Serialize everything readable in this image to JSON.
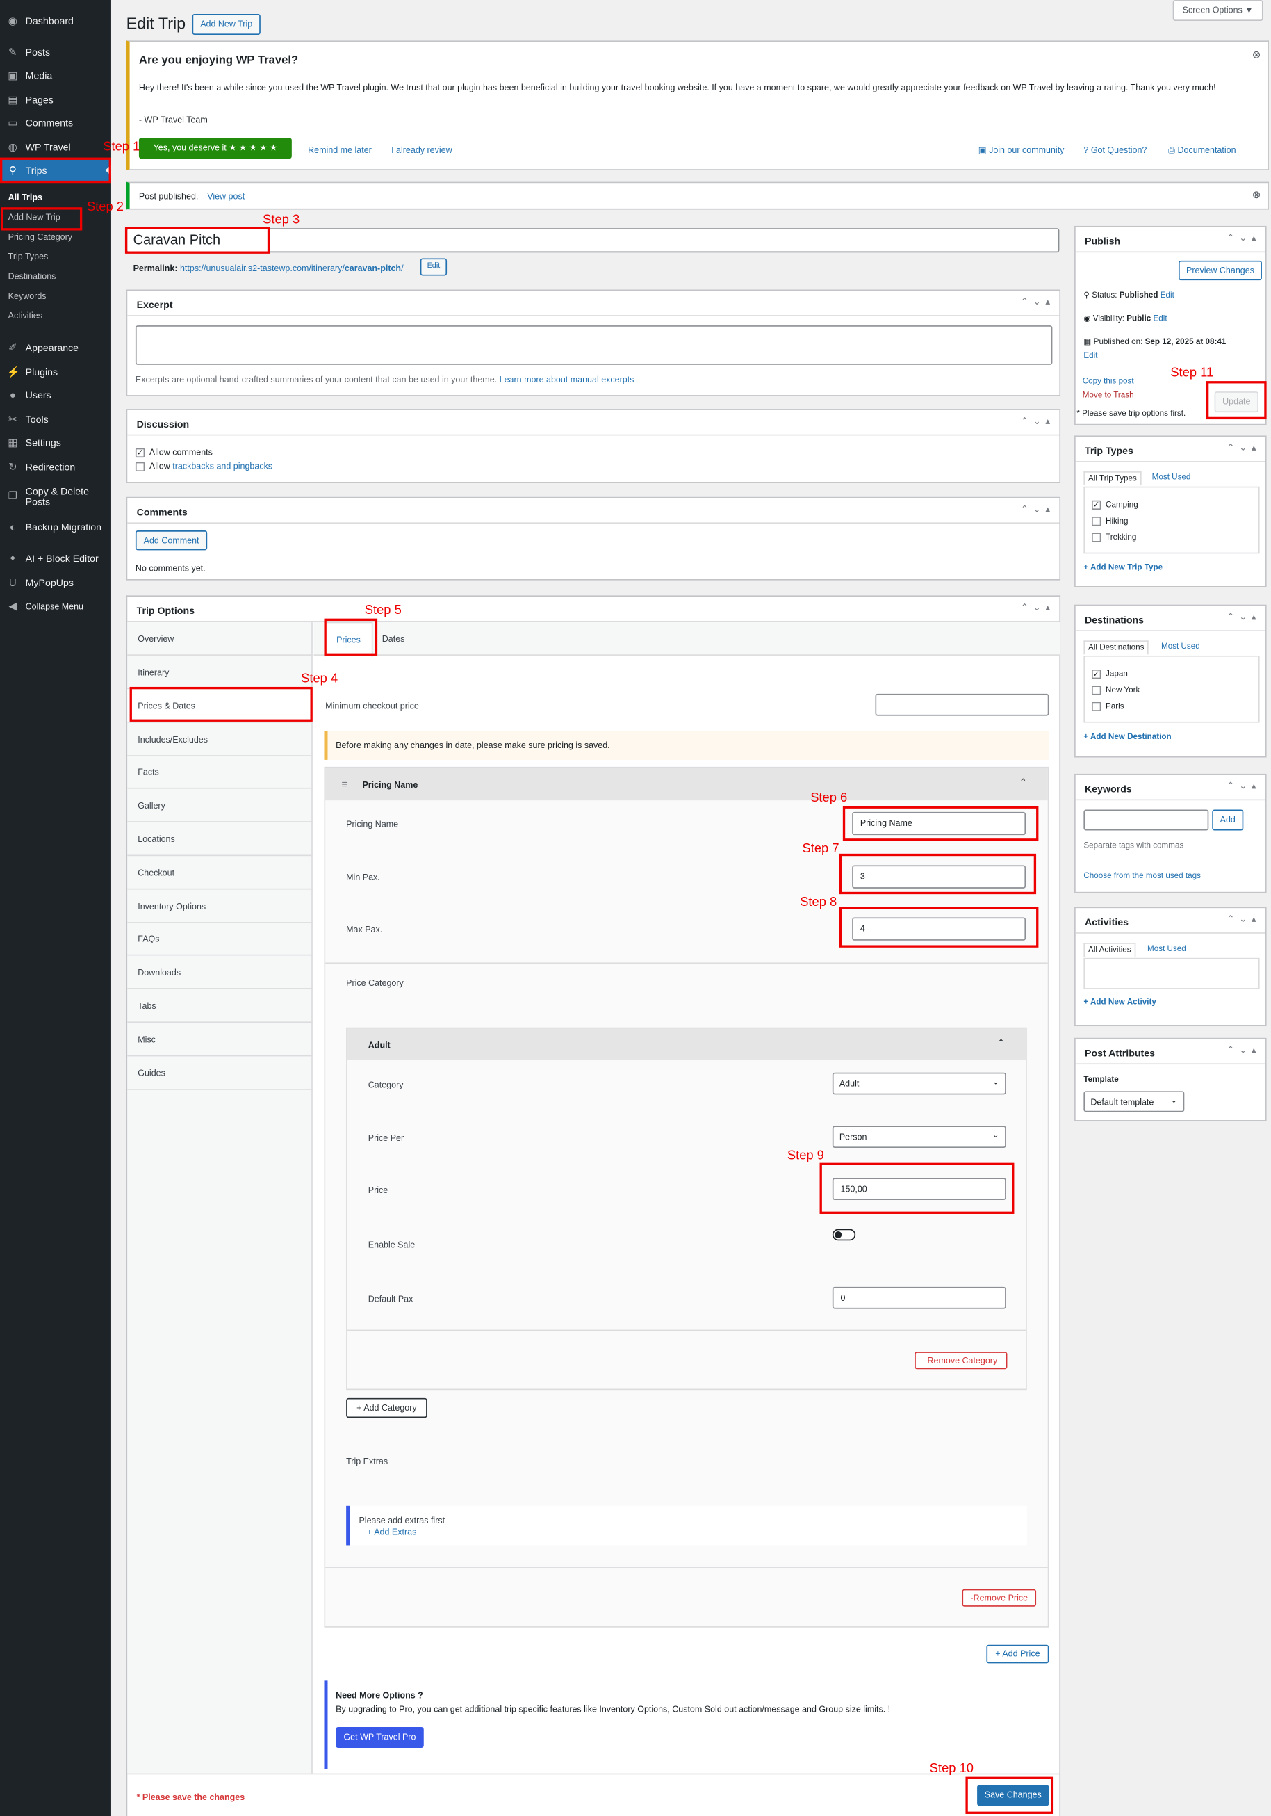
{
  "sidebar": {
    "items": [
      {
        "label": "Dashboard",
        "icon": "dashboard-icon"
      },
      {
        "label": "Posts",
        "icon": "pin-icon"
      },
      {
        "label": "Media",
        "icon": "media-icon"
      },
      {
        "label": "Pages",
        "icon": "pages-icon"
      },
      {
        "label": "Comments",
        "icon": "comments-icon"
      },
      {
        "label": "WP Travel",
        "icon": "wp-travel-icon"
      },
      {
        "label": "Trips",
        "icon": "location-pin-icon"
      },
      {
        "label": "Appearance",
        "icon": "brush-icon"
      },
      {
        "label": "Plugins",
        "icon": "plug-icon"
      },
      {
        "label": "Users",
        "icon": "user-icon"
      },
      {
        "label": "Tools",
        "icon": "wrench-icon"
      },
      {
        "label": "Settings",
        "icon": "settings-icon"
      },
      {
        "label": "Redirection",
        "icon": "redirect-icon"
      },
      {
        "label": "Copy & Delete Posts",
        "icon": "copy-icon"
      },
      {
        "label": "Backup Migration",
        "icon": "backup-icon"
      },
      {
        "label": "AI + Block Editor",
        "icon": "ai-icon"
      },
      {
        "label": "MyPopUps",
        "icon": "popup-icon"
      },
      {
        "label": "Collapse Menu",
        "icon": "collapse-icon"
      }
    ],
    "trips_sub": [
      "All Trips",
      "Add New Trip",
      "Pricing Category",
      "Trip Types",
      "Destinations",
      "Keywords",
      "Activities"
    ]
  },
  "header": {
    "title": "Edit Trip",
    "add_new": "Add New Trip",
    "screen_options": "Screen Options ▼"
  },
  "notice": {
    "title": "Are you enjoying WP Travel?",
    "body": "Hey there! It's been a while since you used the WP Travel plugin. We trust that our plugin has been beneficial in building your travel booking website. If you have a moment to spare, we would greatly appreciate your feedback on WP Travel by leaving a rating. Thank you very much!",
    "team": "- WP Travel Team",
    "yes": "Yes, you deserve it ★ ★ ★ ★ ★",
    "remind": "Remind me later",
    "already": "I already review",
    "community": "Join our community",
    "question": "Got Question?",
    "docs": "Documentation"
  },
  "published": {
    "text": "Post published.",
    "link": "View post"
  },
  "title_value": "Caravan Pitch",
  "permalink": {
    "label": "Permalink:",
    "url_base": "https://unusualair.s2-tastewp.com/itinerary/",
    "slug": "caravan-pitch",
    "url_end": "/",
    "edit": "Edit"
  },
  "excerpt": {
    "title": "Excerpt",
    "help": "Excerpts are optional hand-crafted summaries of your content that can be used in your theme.",
    "link": "Learn more about manual excerpts"
  },
  "discussion": {
    "title": "Discussion",
    "allow_comments": "Allow comments",
    "allow": "Allow",
    "trackbacks": "trackbacks and pingbacks"
  },
  "comments": {
    "title": "Comments",
    "add": "Add Comment",
    "none": "No comments yet."
  },
  "trip_options": {
    "title": "Trip Options",
    "tabs": [
      "Overview",
      "Itinerary",
      "Prices & Dates",
      "Includes/Excludes",
      "Facts",
      "Gallery",
      "Locations",
      "Checkout",
      "Inventory Options",
      "FAQs",
      "Downloads",
      "Tabs",
      "Misc",
      "Guides"
    ],
    "subtabs": [
      "Prices",
      "Dates"
    ],
    "min_checkout": "Minimum checkout price",
    "warning": "Before making any changes in date, please make sure pricing is saved.",
    "pricing_header": "Pricing Name",
    "pricing_name_label": "Pricing Name",
    "pricing_name_value": "Pricing Name",
    "min_pax_label": "Min Pax.",
    "min_pax_value": "3",
    "max_pax_label": "Max Pax.",
    "max_pax_value": "4",
    "price_category": "Price Category",
    "cat_header": "Adult",
    "category_label": "Category",
    "category_value": "Adult",
    "price_per_label": "Price Per",
    "price_per_value": "Person",
    "price_label": "Price",
    "price_value": "150,00",
    "enable_sale": "Enable Sale",
    "default_pax_label": "Default Pax",
    "default_pax_value": "0",
    "remove_category": "-Remove Category",
    "add_category": "+ Add Category",
    "trip_extras": "Trip Extras",
    "extras_note": "Please add extras first",
    "add_extras": "+ Add Extras",
    "remove_price": "-Remove Price",
    "add_price": "+ Add Price",
    "pro_title": "Need More Options ?",
    "pro_body": "By upgrading to Pro, you can get additional trip specific features like Inventory Options, Custom Sold out action/message and Group size limits. !",
    "pro_btn": "Get WP Travel Pro",
    "save_note": "* Please save the changes",
    "save_btn": "Save Changes"
  },
  "publish": {
    "title": "Publish",
    "preview": "Preview Changes",
    "status_label": "Status:",
    "status": "Published",
    "visibility_label": "Visibility:",
    "visibility": "Public",
    "published_on_label": "Published on:",
    "published_on": "Sep 12, 2025 at 08:41",
    "edit": "Edit",
    "copy": "Copy this post",
    "trash": "Move to Trash",
    "update": "Update",
    "note": "* Please save trip options first."
  },
  "trip_types": {
    "title": "Trip Types",
    "tab_all": "All Trip Types",
    "tab_used": "Most Used",
    "items": [
      "Camping",
      "Hiking",
      "Trekking"
    ],
    "add": "+ Add New Trip Type"
  },
  "destinations": {
    "title": "Destinations",
    "tab_all": "All Destinations",
    "tab_used": "Most Used",
    "items": [
      "Japan",
      "New York",
      "Paris"
    ],
    "add": "+ Add New Destination"
  },
  "keywords": {
    "title": "Keywords",
    "add": "Add",
    "help": "Separate tags with commas",
    "choose": "Choose from the most used tags"
  },
  "activities": {
    "title": "Activities",
    "tab_all": "All Activities",
    "tab_used": "Most Used",
    "add": "+ Add New Activity"
  },
  "post_attributes": {
    "title": "Post Attributes",
    "template_label": "Template",
    "template": "Default template"
  },
  "steps": [
    "Step 1",
    "Step 2",
    "Step 3",
    "Step 4",
    "Step 5",
    "Step 6",
    "Step 7",
    "Step 8",
    "Step 9",
    "Step 10",
    "Step 11"
  ],
  "colors": {
    "sidebar": "#1d2327",
    "accent": "#2271b1",
    "highlight": "#e00000"
  }
}
